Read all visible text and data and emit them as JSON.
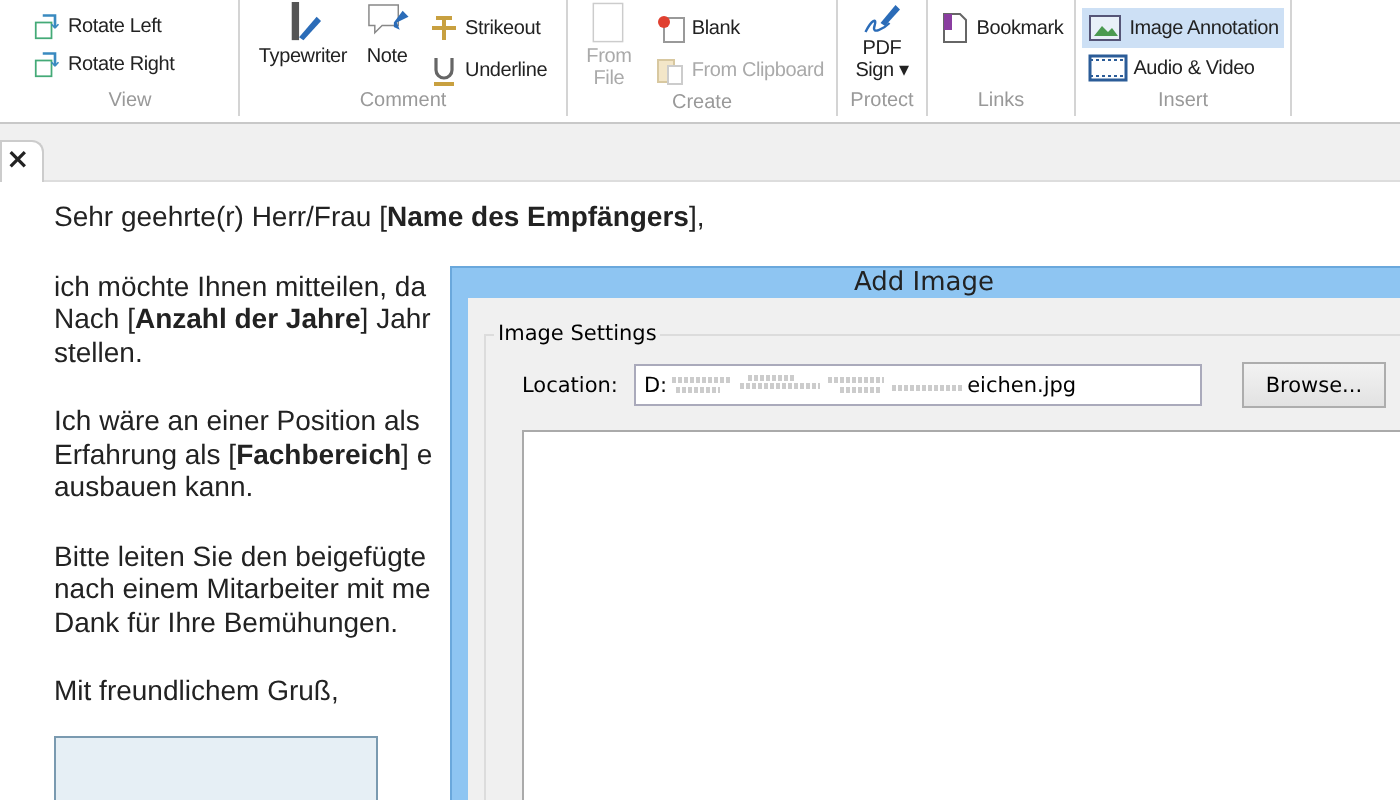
{
  "ribbon": {
    "groups": [
      {
        "label": "View",
        "items": [
          {
            "kind": "small",
            "label": "Rotate Left",
            "disabled": false,
            "selected": false
          },
          {
            "kind": "small",
            "label": "Rotate Right",
            "disabled": false,
            "selected": false
          }
        ]
      },
      {
        "label": "Comment",
        "items": [
          {
            "kind": "large",
            "label": "Typewriter",
            "disabled": false,
            "selected": false
          },
          {
            "kind": "large",
            "label": "Note",
            "disabled": false,
            "selected": false
          },
          {
            "kind": "small",
            "label": "Strikeout",
            "disabled": false,
            "selected": false
          },
          {
            "kind": "small",
            "label": "Underline",
            "disabled": false,
            "selected": false
          }
        ]
      },
      {
        "label": "Create",
        "items": [
          {
            "kind": "large",
            "label": "From File",
            "disabled": true,
            "selected": false
          },
          {
            "kind": "small",
            "label": "Blank",
            "disabled": false,
            "selected": false
          },
          {
            "kind": "small",
            "label": "From Clipboard",
            "disabled": true,
            "selected": false
          }
        ]
      },
      {
        "label": "Protect",
        "items": [
          {
            "kind": "large",
            "label": "PDF Sign",
            "caret": "▾",
            "disabled": false,
            "selected": false
          }
        ]
      },
      {
        "label": "Links",
        "items": [
          {
            "kind": "small",
            "label": "Bookmark",
            "disabled": false,
            "selected": false
          }
        ]
      },
      {
        "label": "Insert",
        "items": [
          {
            "kind": "small",
            "label": "Image Annotation",
            "disabled": false,
            "selected": true
          },
          {
            "kind": "small",
            "label": "Audio & Video",
            "disabled": false,
            "selected": false
          }
        ]
      }
    ]
  },
  "tab": {
    "close": "×"
  },
  "document": {
    "paragraphs": [
      [
        "Sehr geehrte(r) Herr/Frau [**Name des Empfängers**],"
      ],
      [
        "ich möchte Ihnen mitteilen, da",
        "Nach [**Anzahl der Jahre**] Jahr",
        "stellen."
      ],
      [
        "Ich wäre an einer Position als",
        "Erfahrung als [**Fachbereich**] e",
        "ausbauen kann."
      ],
      [
        "Bitte leiten Sie den beigefügte",
        "nach einem Mitarbeiter mit me",
        "Dank für Ihre Bemühungen."
      ],
      [
        "Mit freundlichem Gruß,"
      ]
    ]
  },
  "dialog": {
    "title": "Add Image",
    "group": "Image Settings",
    "location_label": "Location:",
    "location_start": "D:",
    "location_end": "eichen.jpg",
    "browse": "Browse..."
  }
}
